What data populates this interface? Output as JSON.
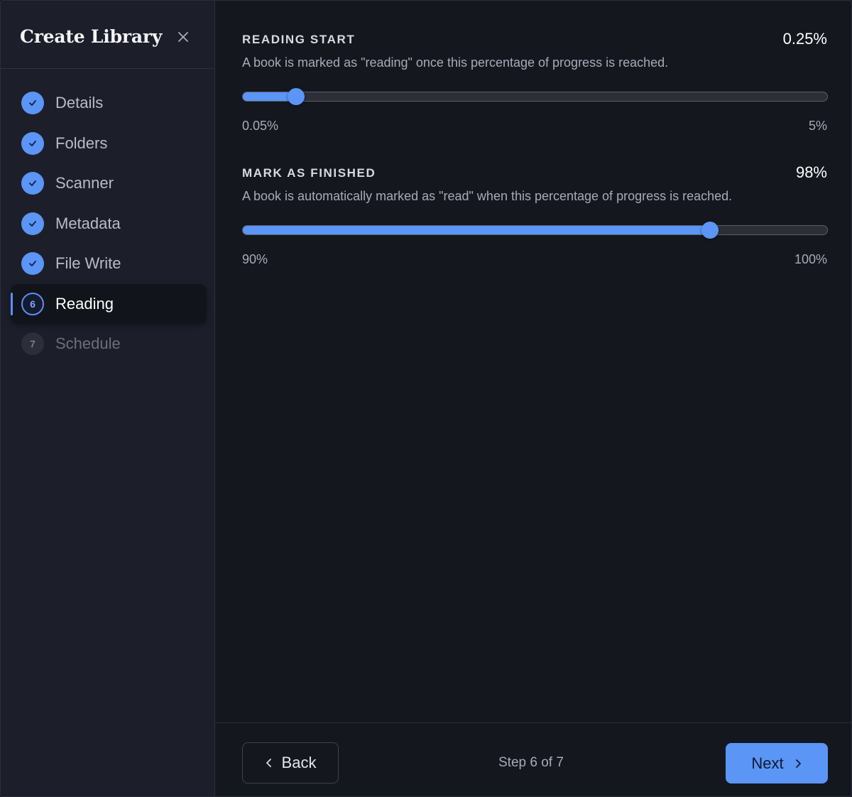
{
  "dialog": {
    "title": "Create Library"
  },
  "sidebar": {
    "steps": [
      {
        "label": "Details",
        "status": "done",
        "icon": "check-icon"
      },
      {
        "label": "Folders",
        "status": "done",
        "icon": "check-icon"
      },
      {
        "label": "Scanner",
        "status": "done",
        "icon": "check-icon"
      },
      {
        "label": "Metadata",
        "status": "done",
        "icon": "check-icon"
      },
      {
        "label": "File Write",
        "status": "done",
        "icon": "check-icon"
      },
      {
        "label": "Reading",
        "status": "current",
        "number": "6"
      },
      {
        "label": "Schedule",
        "status": "todo",
        "number": "7"
      }
    ]
  },
  "reading_start": {
    "title": "READING START",
    "value": "0.25%",
    "description": "A book is marked as \"reading\" once this percentage of progress is reached.",
    "min_label": "0.05%",
    "max_label": "5%",
    "min": 0.05,
    "max": 5,
    "current": 0.25
  },
  "mark_finished": {
    "title": "MARK AS FINISHED",
    "value": "98%",
    "description": "A book is automatically marked as \"read\" when this percentage of progress is reached.",
    "min_label": "90%",
    "max_label": "100%",
    "min": 90,
    "max": 100,
    "current": 98
  },
  "footer": {
    "back_label": "Back",
    "step_info": "Step 6 of 7",
    "next_label": "Next"
  },
  "colors": {
    "accent": "#5b95f5",
    "background": "#15171f",
    "sidebar": "#1c1f2a"
  }
}
